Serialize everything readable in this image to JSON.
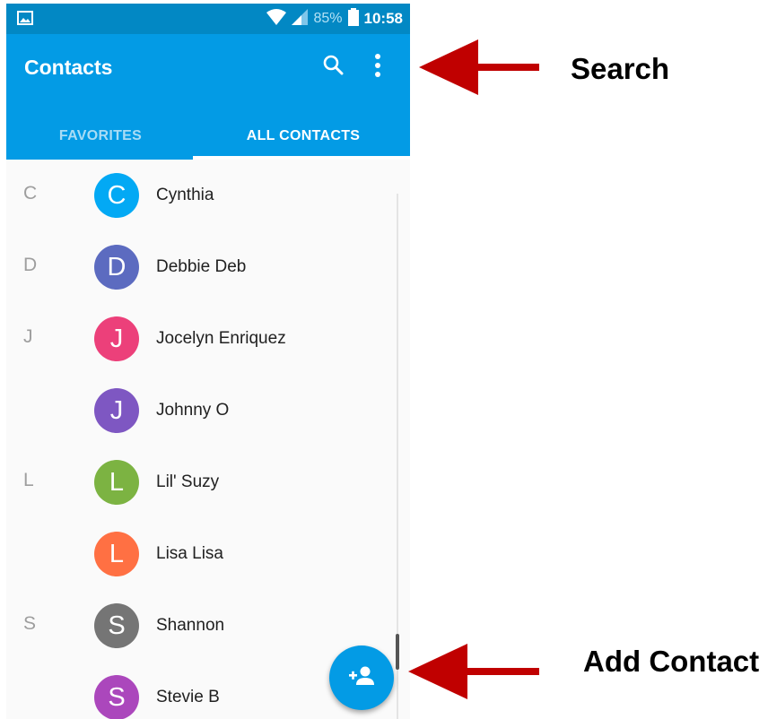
{
  "status_bar": {
    "battery": "85%",
    "time": "10:58",
    "icons": [
      "image-icon",
      "wifi-icon",
      "signal-icon",
      "battery-icon"
    ]
  },
  "app_bar": {
    "title": "Contacts",
    "actions": [
      "search-icon",
      "more-vert-icon"
    ],
    "color": "#039be5"
  },
  "tabs": [
    {
      "label": "FAVORITES",
      "selected": false
    },
    {
      "label": "ALL CONTACTS",
      "selected": true
    }
  ],
  "contacts": [
    {
      "section": "C",
      "initial": "C",
      "name": "Cynthia",
      "color": "#03a9f4"
    },
    {
      "section": "D",
      "initial": "D",
      "name": "Debbie Deb",
      "color": "#5c6bc0"
    },
    {
      "section": "J",
      "initial": "J",
      "name": "Jocelyn Enriquez",
      "color": "#ec407a"
    },
    {
      "section": "",
      "initial": "J",
      "name": "Johnny O",
      "color": "#7e57c2"
    },
    {
      "section": "L",
      "initial": "L",
      "name": "Lil' Suzy",
      "color": "#7cb342"
    },
    {
      "section": "",
      "initial": "L",
      "name": "Lisa Lisa",
      "color": "#ff7043"
    },
    {
      "section": "S",
      "initial": "S",
      "name": "Shannon",
      "color": "#757575"
    },
    {
      "section": "",
      "initial": "S",
      "name": "Stevie B",
      "color": "#ab47bc"
    }
  ],
  "fab": {
    "icon": "add-person-icon"
  },
  "annotations": {
    "search_label": "Search",
    "add_contact_label": "Add Contact",
    "arrow_color": "#c00000"
  }
}
